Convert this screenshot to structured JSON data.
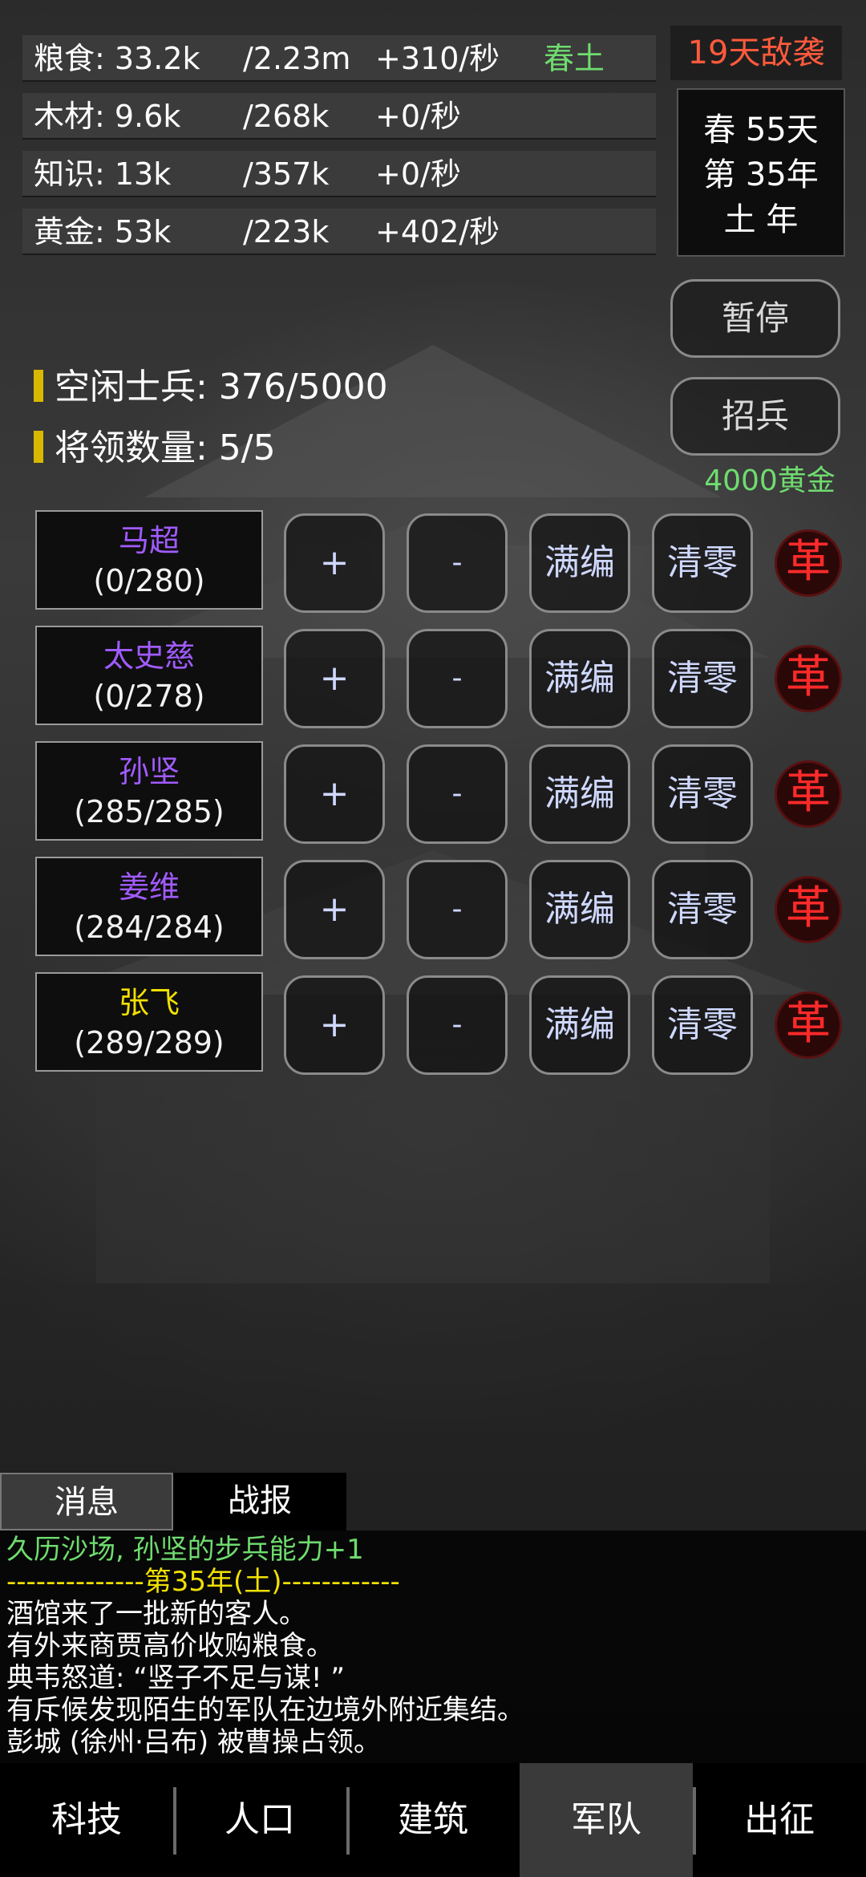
{
  "resources": [
    {
      "name": "粮食: 33.2k",
      "cap": "/2.23m",
      "rate": "+310/秒",
      "season": "春土"
    },
    {
      "name": "木材: 9.6k",
      "cap": "/268k",
      "rate": "+0/秒"
    },
    {
      "name": "知识: 13k",
      "cap": "/357k",
      "rate": "+0/秒"
    },
    {
      "name": "黄金: 53k",
      "cap": "/223k",
      "rate": "+402/秒"
    }
  ],
  "enemy_warning": "19天敌袭",
  "date": {
    "line1": "春 55天",
    "line2": "第 35年",
    "line3": "土 年"
  },
  "buttons": {
    "pause": "暂停",
    "recruit": "招兵",
    "recruit_cost": "4000黄金"
  },
  "stats": {
    "idle_soldiers": "空闲士兵:  376/5000",
    "general_count": "将领数量:  5/5"
  },
  "row_actions": {
    "plus": "+",
    "minus": "-",
    "full": "满编",
    "clear": "清零",
    "dismiss": "革"
  },
  "generals": [
    {
      "name": "马超",
      "count": "(0/280)",
      "color": "#a15bff"
    },
    {
      "name": "太史慈",
      "count": "(0/278)",
      "color": "#a15bff"
    },
    {
      "name": "孙坚",
      "count": "(285/285)",
      "color": "#a15bff"
    },
    {
      "name": "姜维",
      "count": "(284/284)",
      "color": "#a15bff"
    },
    {
      "name": "张飞",
      "count": "(289/289)",
      "color": "#f0e000"
    }
  ],
  "message_tabs": {
    "messages": "消息",
    "battle_report": "战报"
  },
  "log": [
    {
      "text": "久历沙场, 孙坚的步兵能力+1",
      "color": "#6fdc6f"
    },
    {
      "text": "--------------第35年(土)------------",
      "color": "#f0e000"
    },
    {
      "text": "酒馆来了一批新的客人。",
      "color": "#ffffff"
    },
    {
      "text": "有外来商贾高价收购粮食。",
      "color": "#ffffff"
    },
    {
      "text": "典韦怒道: “竖子不足与谋! ”",
      "color": "#ffffff"
    },
    {
      "text": "有斥候发现陌生的军队在边境外附近集结。",
      "color": "#ffffff"
    },
    {
      "text": "彭城 (徐州·吕布) 被曹操占领。",
      "color": "#ffffff"
    }
  ],
  "nav": [
    "科技",
    "人口",
    "建筑",
    "军队",
    "出征"
  ],
  "active_nav": "军队"
}
